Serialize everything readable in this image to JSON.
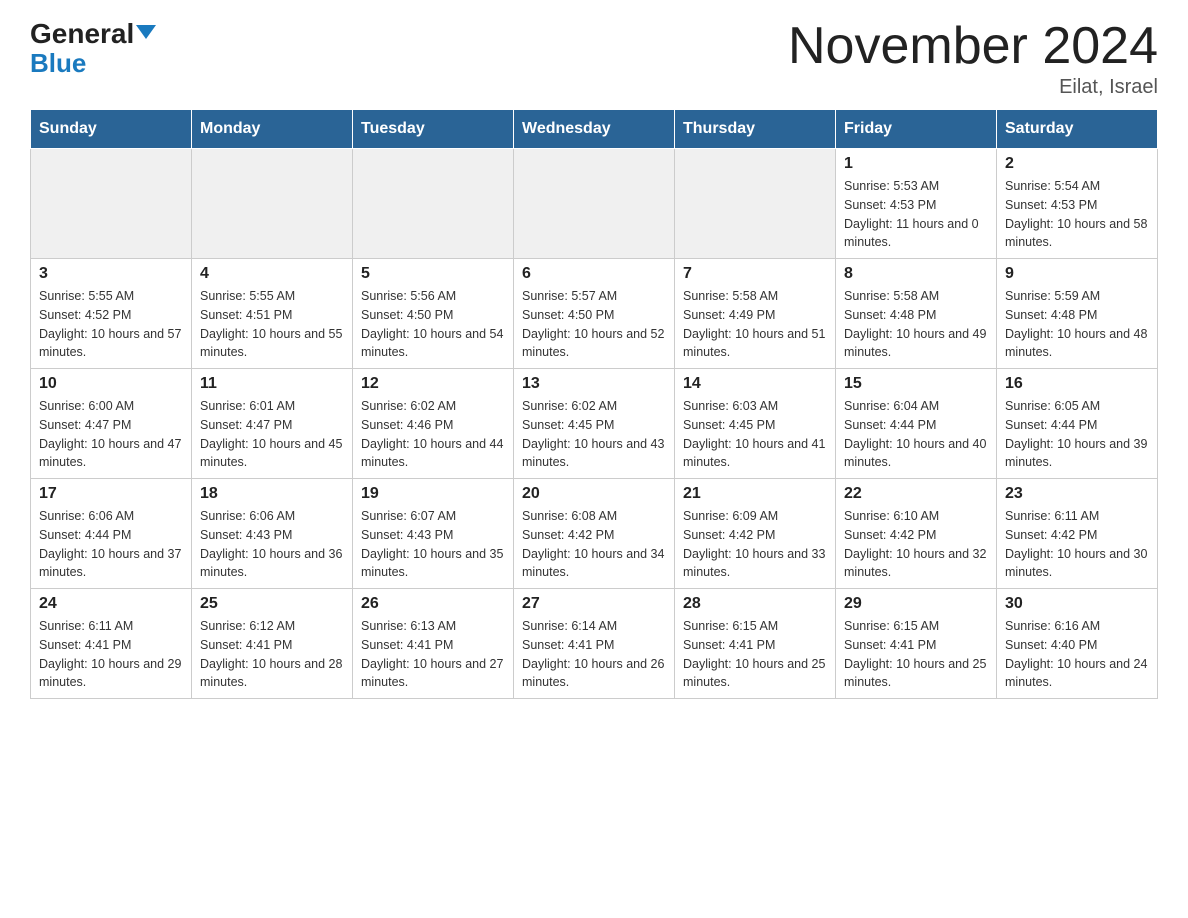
{
  "logo": {
    "general": "General",
    "triangle": "▼",
    "blue": "Blue"
  },
  "header": {
    "month_title": "November 2024",
    "location": "Eilat, Israel"
  },
  "weekdays": [
    "Sunday",
    "Monday",
    "Tuesday",
    "Wednesday",
    "Thursday",
    "Friday",
    "Saturday"
  ],
  "weeks": [
    [
      {
        "day": "",
        "info": ""
      },
      {
        "day": "",
        "info": ""
      },
      {
        "day": "",
        "info": ""
      },
      {
        "day": "",
        "info": ""
      },
      {
        "day": "",
        "info": ""
      },
      {
        "day": "1",
        "info": "Sunrise: 5:53 AM\nSunset: 4:53 PM\nDaylight: 11 hours and 0 minutes."
      },
      {
        "day": "2",
        "info": "Sunrise: 5:54 AM\nSunset: 4:53 PM\nDaylight: 10 hours and 58 minutes."
      }
    ],
    [
      {
        "day": "3",
        "info": "Sunrise: 5:55 AM\nSunset: 4:52 PM\nDaylight: 10 hours and 57 minutes."
      },
      {
        "day": "4",
        "info": "Sunrise: 5:55 AM\nSunset: 4:51 PM\nDaylight: 10 hours and 55 minutes."
      },
      {
        "day": "5",
        "info": "Sunrise: 5:56 AM\nSunset: 4:50 PM\nDaylight: 10 hours and 54 minutes."
      },
      {
        "day": "6",
        "info": "Sunrise: 5:57 AM\nSunset: 4:50 PM\nDaylight: 10 hours and 52 minutes."
      },
      {
        "day": "7",
        "info": "Sunrise: 5:58 AM\nSunset: 4:49 PM\nDaylight: 10 hours and 51 minutes."
      },
      {
        "day": "8",
        "info": "Sunrise: 5:58 AM\nSunset: 4:48 PM\nDaylight: 10 hours and 49 minutes."
      },
      {
        "day": "9",
        "info": "Sunrise: 5:59 AM\nSunset: 4:48 PM\nDaylight: 10 hours and 48 minutes."
      }
    ],
    [
      {
        "day": "10",
        "info": "Sunrise: 6:00 AM\nSunset: 4:47 PM\nDaylight: 10 hours and 47 minutes."
      },
      {
        "day": "11",
        "info": "Sunrise: 6:01 AM\nSunset: 4:47 PM\nDaylight: 10 hours and 45 minutes."
      },
      {
        "day": "12",
        "info": "Sunrise: 6:02 AM\nSunset: 4:46 PM\nDaylight: 10 hours and 44 minutes."
      },
      {
        "day": "13",
        "info": "Sunrise: 6:02 AM\nSunset: 4:45 PM\nDaylight: 10 hours and 43 minutes."
      },
      {
        "day": "14",
        "info": "Sunrise: 6:03 AM\nSunset: 4:45 PM\nDaylight: 10 hours and 41 minutes."
      },
      {
        "day": "15",
        "info": "Sunrise: 6:04 AM\nSunset: 4:44 PM\nDaylight: 10 hours and 40 minutes."
      },
      {
        "day": "16",
        "info": "Sunrise: 6:05 AM\nSunset: 4:44 PM\nDaylight: 10 hours and 39 minutes."
      }
    ],
    [
      {
        "day": "17",
        "info": "Sunrise: 6:06 AM\nSunset: 4:44 PM\nDaylight: 10 hours and 37 minutes."
      },
      {
        "day": "18",
        "info": "Sunrise: 6:06 AM\nSunset: 4:43 PM\nDaylight: 10 hours and 36 minutes."
      },
      {
        "day": "19",
        "info": "Sunrise: 6:07 AM\nSunset: 4:43 PM\nDaylight: 10 hours and 35 minutes."
      },
      {
        "day": "20",
        "info": "Sunrise: 6:08 AM\nSunset: 4:42 PM\nDaylight: 10 hours and 34 minutes."
      },
      {
        "day": "21",
        "info": "Sunrise: 6:09 AM\nSunset: 4:42 PM\nDaylight: 10 hours and 33 minutes."
      },
      {
        "day": "22",
        "info": "Sunrise: 6:10 AM\nSunset: 4:42 PM\nDaylight: 10 hours and 32 minutes."
      },
      {
        "day": "23",
        "info": "Sunrise: 6:11 AM\nSunset: 4:42 PM\nDaylight: 10 hours and 30 minutes."
      }
    ],
    [
      {
        "day": "24",
        "info": "Sunrise: 6:11 AM\nSunset: 4:41 PM\nDaylight: 10 hours and 29 minutes."
      },
      {
        "day": "25",
        "info": "Sunrise: 6:12 AM\nSunset: 4:41 PM\nDaylight: 10 hours and 28 minutes."
      },
      {
        "day": "26",
        "info": "Sunrise: 6:13 AM\nSunset: 4:41 PM\nDaylight: 10 hours and 27 minutes."
      },
      {
        "day": "27",
        "info": "Sunrise: 6:14 AM\nSunset: 4:41 PM\nDaylight: 10 hours and 26 minutes."
      },
      {
        "day": "28",
        "info": "Sunrise: 6:15 AM\nSunset: 4:41 PM\nDaylight: 10 hours and 25 minutes."
      },
      {
        "day": "29",
        "info": "Sunrise: 6:15 AM\nSunset: 4:41 PM\nDaylight: 10 hours and 25 minutes."
      },
      {
        "day": "30",
        "info": "Sunrise: 6:16 AM\nSunset: 4:40 PM\nDaylight: 10 hours and 24 minutes."
      }
    ]
  ]
}
